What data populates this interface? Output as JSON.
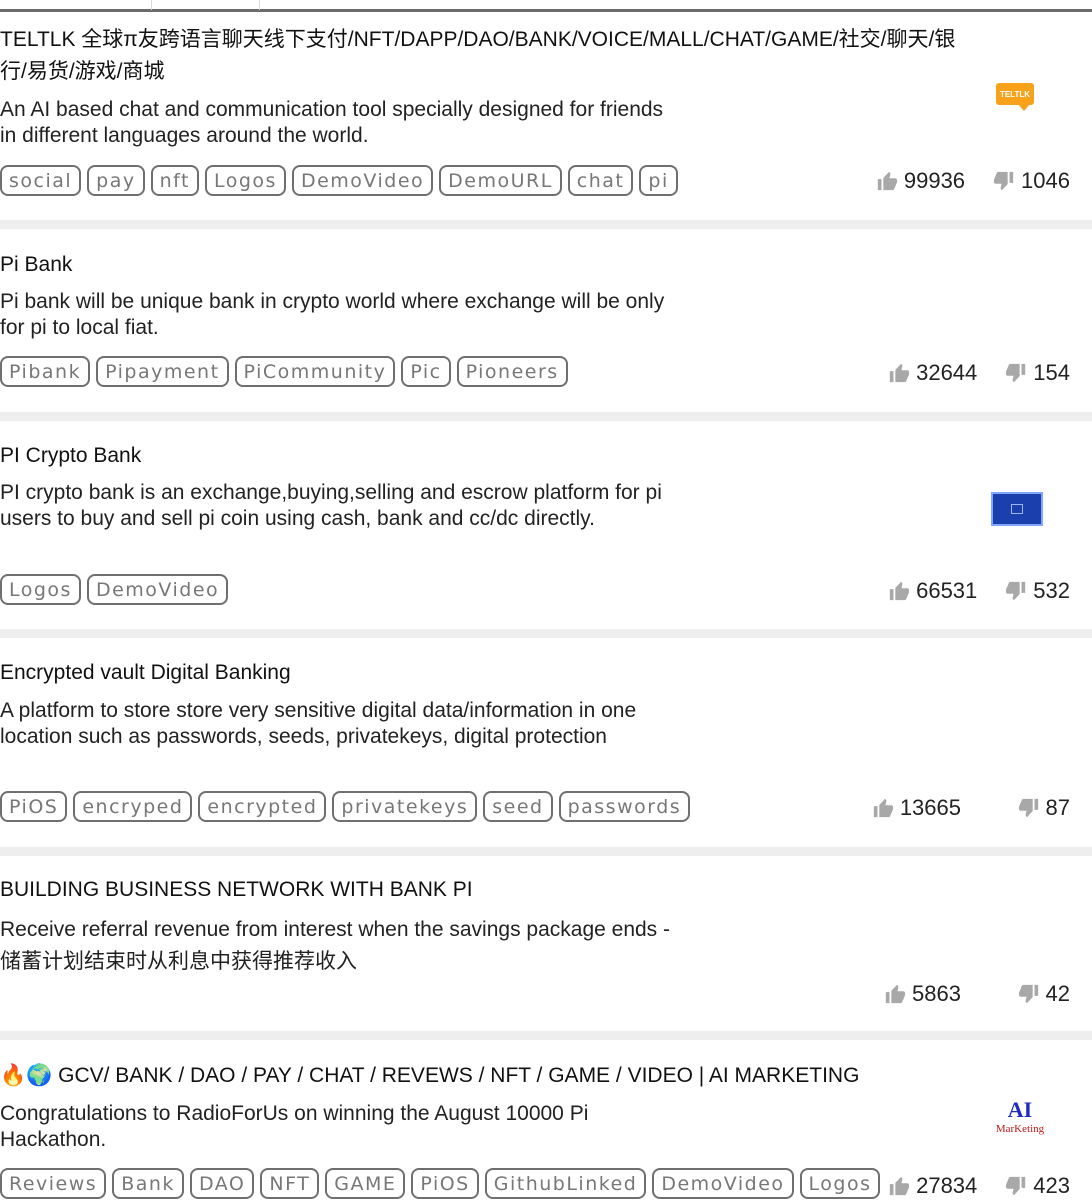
{
  "projects": [
    {
      "title": "TELTLK 全球π友跨语言聊天线下支付/NFT/DAPP/DAO/BANK/VOICE/MALL/CHAT/GAME/社交/聊天/银行/易货/游戏/商城",
      "description": "An AI based chat and communication tool specially designed for friends in different languages around the world.",
      "tags": [
        "social",
        "pay",
        "nft",
        "Logos",
        "DemoVideo",
        "DemoURL",
        "chat",
        "pi"
      ],
      "upvotes": "99936",
      "downvotes": "1046",
      "logo_text": "TELTLK",
      "logo_color": "#f7a21a"
    },
    {
      "title": "Pi Bank",
      "description": "Pi bank will be unique bank in crypto world where exchange will be only for pi to local fiat.",
      "tags": [
        "Pibank",
        "Pipayment",
        "PiCommunity",
        "Pic",
        "Pioneers"
      ],
      "upvotes": "32644",
      "downvotes": "154"
    },
    {
      "title": "PI Crypto Bank",
      "description": "PI crypto bank is an exchange,buying,selling and escrow platform for pi users to buy and sell pi coin using cash, bank and cc/dc directly.",
      "tags": [
        "Logos",
        "DemoVideo"
      ],
      "upvotes": "66531",
      "downvotes": "532",
      "logo_color": "#1c3fae"
    },
    {
      "title": "Encrypted vault Digital Banking",
      "description": "A platform to store store very sensitive digital data/information in one location such as passwords, seeds, privatekeys, digital protection",
      "tags": [
        "PiOS",
        "encryped",
        "encrypted",
        "privatekeys",
        "seed",
        "passwords"
      ],
      "upvotes": "13665",
      "downvotes": "87"
    },
    {
      "title": "BUILDING BUSINESS NETWORK WITH BANK PI",
      "description": "Receive referral revenue from interest when the savings package ends - 储蓄计划结束时从利息中获得推荐收入",
      "tags": [],
      "upvotes": "5863",
      "downvotes": "42"
    },
    {
      "title": "🔥🌍 GCV/ BANK / DAO / PAY / CHAT / REVEWS / NFT / GAME / VIDEO | AI MARKETING",
      "description": "Congratulations to RadioForUs on winning the August 10000 Pi Hackathon.",
      "tags": [
        "Reviews",
        "Bank",
        "DAO",
        "NFT",
        "GAME",
        "PiOS",
        "GithubLinked",
        "DemoVideo",
        "Logos"
      ],
      "upvotes": "27834",
      "downvotes": "423",
      "logo_text": "AI",
      "logo_subtext": "MarKeting"
    }
  ],
  "icons": {
    "upvote": "thumbs-up-icon",
    "downvote": "thumbs-down-icon"
  }
}
